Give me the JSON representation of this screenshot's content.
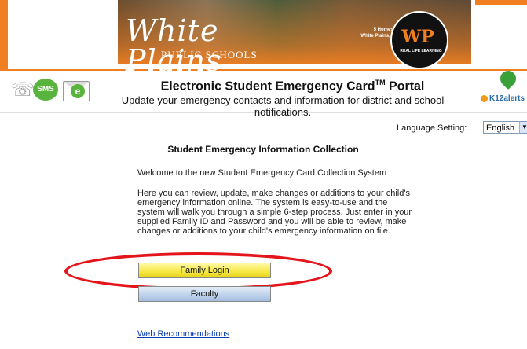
{
  "header": {
    "school_name": "White Plains",
    "school_sub": "PUBLIC SCHOOLS",
    "address_line1": "5 Homeside Lane",
    "address_line2": "White Plains, NY 10605",
    "logo_text": "WP",
    "logo_ring_top": "White Plains Public Schools",
    "logo_ring_bottom": "REAL LIFE LEARNING",
    "portal_title": "Electronic Student Emergency Card",
    "portal_title_mark": "TM",
    "portal_title_suffix": "Portal",
    "portal_subtitle": "Update your emergency contacts and information for district and school notifications.",
    "sms_label": "SMS",
    "email_letter": "e",
    "k12_label": "K12alerts"
  },
  "language": {
    "label": "Language Setting:",
    "selected": "English"
  },
  "main": {
    "title": "Student Emergency Information Collection",
    "welcome": "Welcome to the new Student Emergency Card Collection System",
    "description": "Here you can review, update, make changes or additions to your child's emergency information online. The system is easy-to-use and the system will walk you through a simple 6-step process. Just enter in your supplied Family ID and Password and you will be able to review, make changes or additions to your child's emergency information on file.",
    "family_login_label": "Family Login",
    "faculty_label": "Faculty",
    "web_recommendations_label": "Web Recommendations"
  },
  "colors": {
    "brand_orange": "#f07f22",
    "highlight_red": "#e4141b",
    "family_button": "#f5e840",
    "faculty_button": "#bcd0ea",
    "link_blue": "#0b3fae"
  },
  "icons": [
    "phone-icon",
    "sms-icon",
    "email-icon",
    "k12alerts-heart-icon",
    "dropdown-arrow-icon"
  ]
}
